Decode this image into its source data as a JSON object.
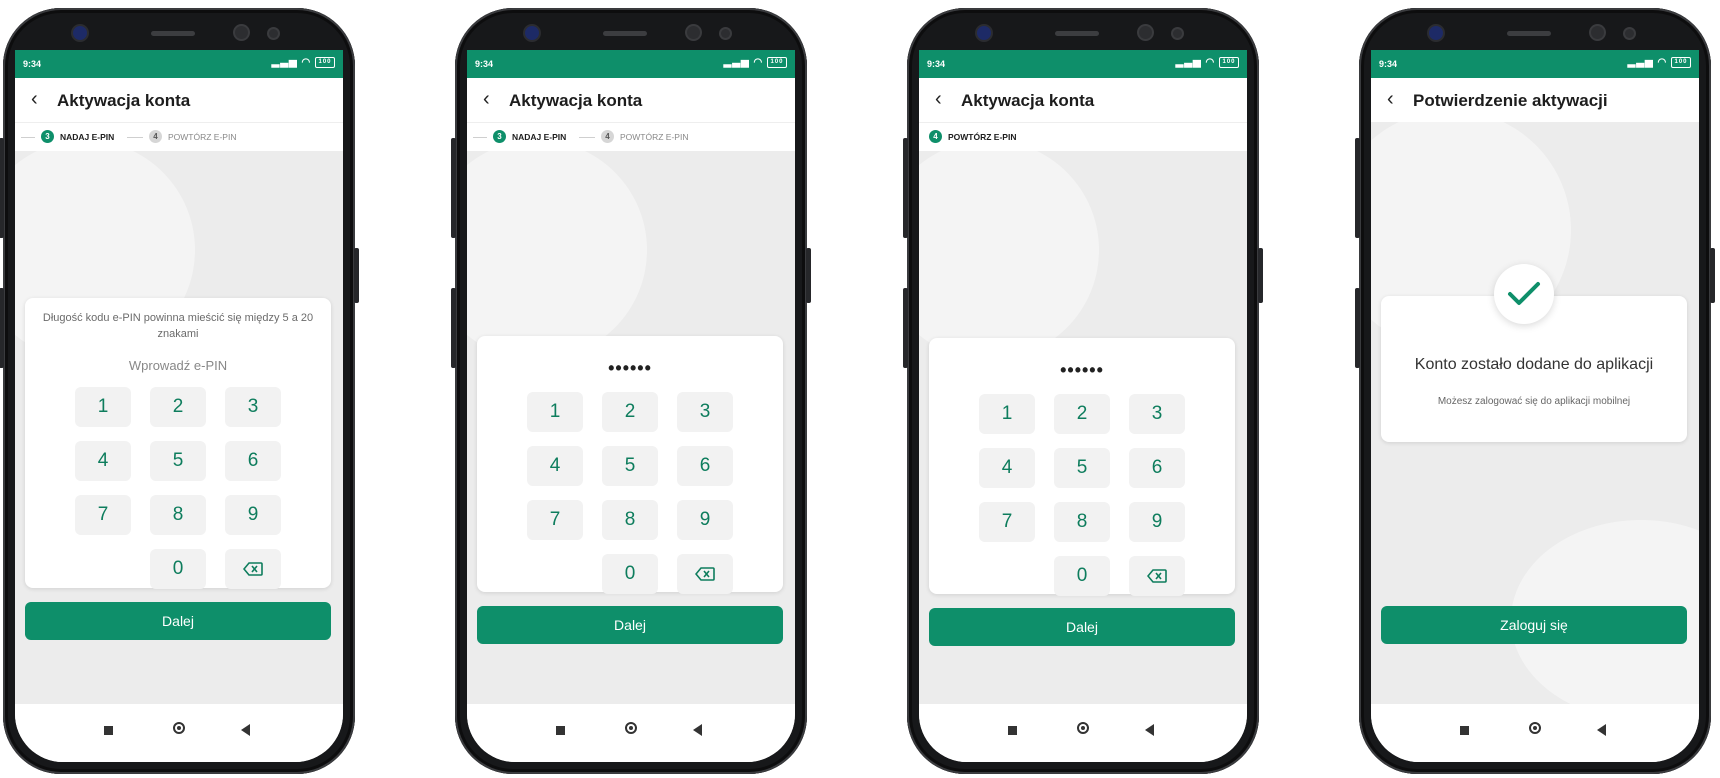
{
  "status": {
    "time": "9:34",
    "battery": "100"
  },
  "screens": [
    {
      "header_title": "Aktywacja konta",
      "steps": [
        {
          "number": "3",
          "label": "NADAJ E-PIN"
        },
        {
          "number": "4",
          "label": "POWTÓRZ E-PIN"
        }
      ],
      "hint": "Długość kodu e-PIN powinna mieścić się między 5 a 20 znakami",
      "prompt": "Wprowadź e-PIN",
      "button": "Dalej"
    },
    {
      "header_title": "Aktywacja konta",
      "steps": [
        {
          "number": "3",
          "label": "NADAJ E-PIN"
        },
        {
          "number": "4",
          "label": "POWTÓRZ E-PIN"
        }
      ],
      "pin_value": "••••••",
      "button": "Dalej"
    },
    {
      "header_title": "Aktywacja konta",
      "steps": [
        {
          "number": "4",
          "label": "POWTÓRZ E-PIN"
        }
      ],
      "pin_value": "••••••",
      "button": "Dalej"
    },
    {
      "header_title": "Potwierdzenie aktywacji",
      "success_title": "Konto zostało dodane do aplikacji",
      "success_sub": "Możesz zalogować się do aplikacji mobilnej",
      "button": "Zaloguj się"
    }
  ],
  "keypad": {
    "keys": [
      "1",
      "2",
      "3",
      "4",
      "5",
      "6",
      "7",
      "8",
      "9",
      "",
      "0",
      "⌫"
    ]
  },
  "icons": {
    "back": "chevron-left-icon",
    "backspace": "backspace-icon",
    "check": "check-icon"
  },
  "colors": {
    "brand": "#0e8f6a",
    "key_text": "#0e7d5d"
  }
}
